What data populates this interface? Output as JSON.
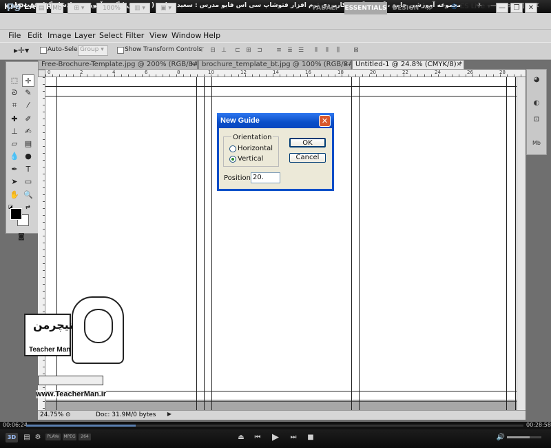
{
  "kmplayer": {
    "logo": "KMPLAYER",
    "title": "مجموعه آموزشی جامع ، گام به گام و کاربردی نرم افزار فتوشاپ سی اس فایو  مدرس : سعید فدایی ( تیچرمن ) گروه آموزشی پادشاه گرافیست ها",
    "window_buttons": [
      "✈",
      "—",
      "▭",
      "□",
      "✕"
    ],
    "time_elapsed": "00:06:24",
    "time_total": "00:28:58",
    "progress_fraction": 0.22,
    "volume_fraction": 0.66,
    "controls": [
      "⏏",
      "⏮",
      "▶",
      "⏭",
      "■"
    ],
    "label_3d": "3D",
    "tags": [
      "PLAYe",
      "MPEG",
      "264"
    ]
  },
  "photoshop": {
    "logo": "Ps",
    "zoom_display": "100%",
    "workspaces": [
      "FADAEI",
      "ESSENTIALS",
      "DESIGN",
      "≫"
    ],
    "active_workspace": "ESSENTIALS",
    "cs_live": "CS Live",
    "menu": [
      "File",
      "Edit",
      "Image",
      "Layer",
      "Select",
      "Filter",
      "View",
      "Window",
      "Help"
    ],
    "options": {
      "auto_select_label": "Auto-Select:",
      "group_value": "Group",
      "show_transform_label": "Show Transform Controls"
    },
    "tabs": [
      {
        "label": "Free-Brochure-Template.jpg @ 200% (RGB/8#)",
        "close": "✕"
      },
      {
        "label": "brochure_template_bt.jpg @ 100% (RGB/8#)",
        "close": "✕"
      },
      {
        "label": "Untitled-1 @ 24.8% (CMYK/8) *",
        "close": "✕"
      }
    ],
    "ruler_numbers": [
      "0",
      "2",
      "4",
      "6",
      "8",
      "10",
      "12",
      "14",
      "16",
      "18",
      "20",
      "22",
      "24",
      "26",
      "28"
    ],
    "status": {
      "zoom": "24.75%",
      "doc_info": "Doc: 31.9M/0 bytes"
    }
  },
  "dialog": {
    "title": "New Guide",
    "close": "✕",
    "orientation_legend": "Orientation",
    "horizontal_label": "Horizontal",
    "vertical_label": "Vertical",
    "selected": "Vertical",
    "ok_label": "OK",
    "cancel_label": "Cancel",
    "position_label": "Position:",
    "position_value": "20."
  },
  "watermark": {
    "logo_text": "تیچرمن",
    "brand": "Teacher Man",
    "url": "www.TeacherMan.ir"
  }
}
